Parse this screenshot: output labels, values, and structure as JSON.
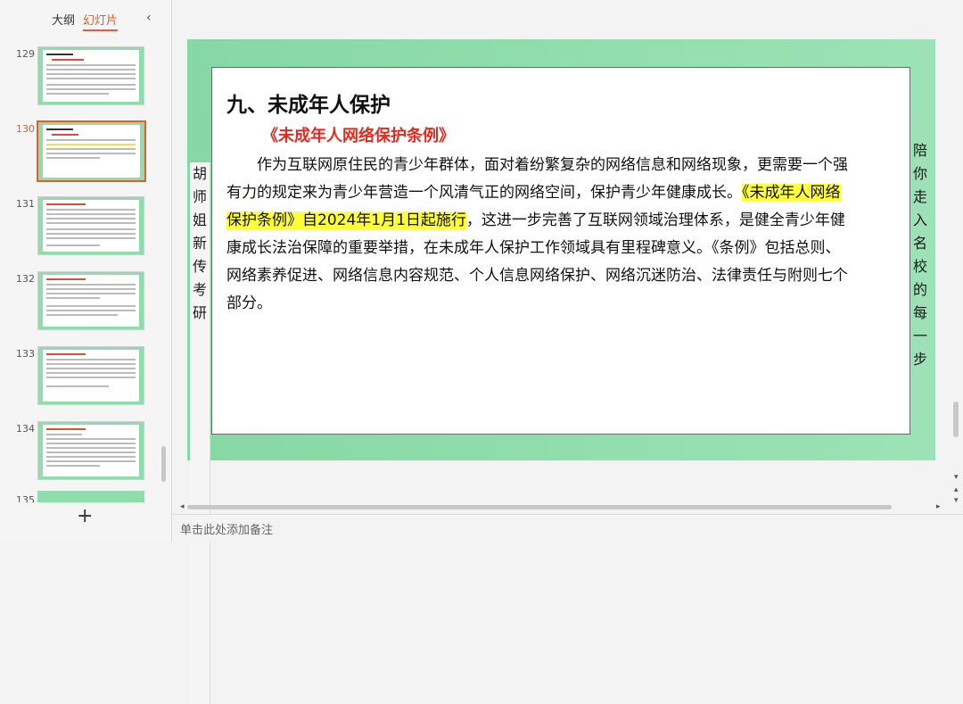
{
  "left_panel": {
    "tabs": {
      "outline": "大纲",
      "slides": "幻灯片"
    },
    "collapse_icon": "chevron-left-icon",
    "thumbnails": [
      {
        "number": "129"
      },
      {
        "number": "130",
        "active": true
      },
      {
        "number": "131"
      },
      {
        "number": "132"
      },
      {
        "number": "133"
      },
      {
        "number": "134"
      },
      {
        "number": "135"
      }
    ],
    "add_slide": "+"
  },
  "slide": {
    "side_left": "胡师姐新传考研",
    "side_right": "陪你走入名校的每一步",
    "title": "九、未成年人保护",
    "subtitle": "《未成年人网络保护条例》",
    "body": {
      "part1": "作为互联网原住民的青少年群体，面对着纷繁复杂的网络信息和网络现象，更需要一个强有力的规定来为青少年营造一个风清气正的网络空间，保护青少年健康成长。",
      "highlight": "《未成年人网络保护条例》自2024年1月1日起施行",
      "part2": "，这进一步完善了互联网领域治理体系，是健全青少年健康成长法治保障的重要举措，在未成年人保护工作领域具有里程碑意义。《条例》包括总则、网络素养促进、网络信息内容规范、个人信息网络保护、网络沉迷防治、法律责任与附则七个部分。"
    },
    "colors": {
      "frame": "#8fdcac",
      "subtitle": "#e12b1f",
      "highlight": "#ffff3a"
    }
  },
  "notes": {
    "placeholder": "单击此处添加备注"
  }
}
